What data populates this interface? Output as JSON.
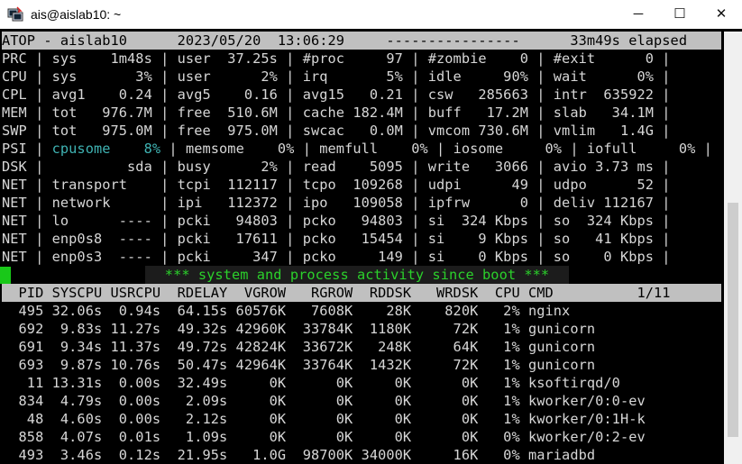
{
  "window": {
    "title": "ais@aislab10: ~",
    "icon": "putty-terminal-icon",
    "buttons": {
      "minimize": "─",
      "maximize": "☐",
      "close": "✕"
    }
  },
  "colors": {
    "background": "#000000",
    "text": "#d7d7d7",
    "header_bar": "#c0c0c0",
    "highlight_cyan": "#3fb3b3",
    "message_green": "#2bd12b"
  },
  "atop": {
    "header": "ATOP - aislab10      2023/05/20  13:06:29     ----------------      33m49s elapsed",
    "system_lines": [
      "PRC | sys    1m48s | user  37.25s | #proc     97 | #zombie    0 | #exit      0 |",
      "CPU | sys       3% | user      2% | irq       5% | idle     90% | wait      0% |",
      "CPL | avg1    0.24 | avg5    0.16 | avg15   0.21 | csw   285663 | intr  635922 |",
      "MEM | tot   976.7M | free  510.6M | cache 182.4M | buff   17.2M | slab   34.1M |",
      "SWP | tot   975.0M | free  975.0M | swcac   0.0M | vmcom 730.6M | vmlim   1.4G |"
    ],
    "psi_line": {
      "prefix": "PSI | ",
      "highlight": "cpusome    8%",
      "suffix": " | memsome    0% | memfull    0% | iosome     0% | iofull     0% |"
    },
    "net_lines": [
      "DSK |          sda | busy      2% | read    5095 | write   3066 | avio 3.73 ms |",
      "NET | transport    | tcpi  112117 | tcpo  109268 | udpi      49 | udpo      52 |",
      "NET | network      | ipi   112372 | ipo   109058 | ipfrw      0 | deliv 112167 |",
      "NET | lo      ---- | pcki   94803 | pcko   94803 | si  324 Kbps | so  324 Kbps |",
      "NET | enp0s8  ---- | pcki   17611 | pcko   15454 | si    9 Kbps | so   41 Kbps |",
      "NET | enp0s3  ---- | pcki     347 | pcko     149 | si    0 Kbps | so    0 Kbps |"
    ],
    "message": "*** system and process activity since boot ***",
    "process_header": "  PID SYSCPU USRCPU  RDELAY  VGROW   RGROW  RDDSK   WRDSK  CPU CMD          1/11",
    "processes": [
      "  495 32.06s  0.94s  64.15s 60576K   7608K    28K    820K   2% nginx",
      "  692  9.83s 11.27s  49.32s 42960K  33784K  1180K     72K   1% gunicorn",
      "  691  9.34s 11.37s  49.72s 42824K  33672K   248K     64K   1% gunicorn",
      "  693  9.87s 10.76s  50.47s 42964K  33764K  1432K     72K   1% gunicorn",
      "   11 13.31s  0.00s  32.49s     0K      0K     0K      0K   1% ksoftirqd/0",
      "  834  4.79s  0.00s   2.09s     0K      0K     0K      0K   1% kworker/0:0-ev",
      "   48  4.60s  0.00s   2.12s     0K      0K     0K      0K   1% kworker/0:1H-k",
      "  858  4.07s  0.01s   1.09s     0K      0K     0K      0K   0% kworker/0:2-ev",
      "  493  3.46s  0.12s  21.95s   1.0G  98700K 34000K     16K   0% mariadbd"
    ]
  }
}
